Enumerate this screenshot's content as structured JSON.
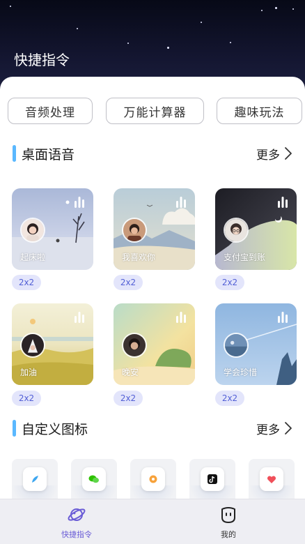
{
  "header": {
    "title": "快捷指令"
  },
  "chips": [
    {
      "label": "音频处理"
    },
    {
      "label": "万能计算器"
    },
    {
      "label": "趣味玩法"
    }
  ],
  "desktop_voice": {
    "title": "桌面语音",
    "more_label": "更多",
    "cards": [
      {
        "name": "起床啦",
        "size": "2x2"
      },
      {
        "name": "我喜欢你",
        "size": "2x2"
      },
      {
        "name": "支付宝到账",
        "size": "2x2"
      },
      {
        "name": "加油",
        "size": "2x2"
      },
      {
        "name": "晚安",
        "size": "2x2"
      },
      {
        "name": "学会珍惜",
        "size": "2x2"
      }
    ]
  },
  "custom_icons": {
    "title": "自定义图标",
    "more_label": "更多",
    "icons": [
      {
        "icon": "feather-icon",
        "color": "#3ea7f0"
      },
      {
        "icon": "wechat-icon",
        "color": "#2dc100"
      },
      {
        "icon": "orange-app-icon",
        "color": "#f7a23b"
      },
      {
        "icon": "tiktok-icon",
        "color": "#111111"
      },
      {
        "icon": "heart-icon",
        "color": "#f0505a"
      }
    ]
  },
  "tabbar": {
    "items": [
      {
        "label": "快捷指令",
        "icon": "planet-icon",
        "active": true
      },
      {
        "label": "我的",
        "icon": "face-icon",
        "active": false
      }
    ],
    "active_color": "#6a5cd6"
  }
}
